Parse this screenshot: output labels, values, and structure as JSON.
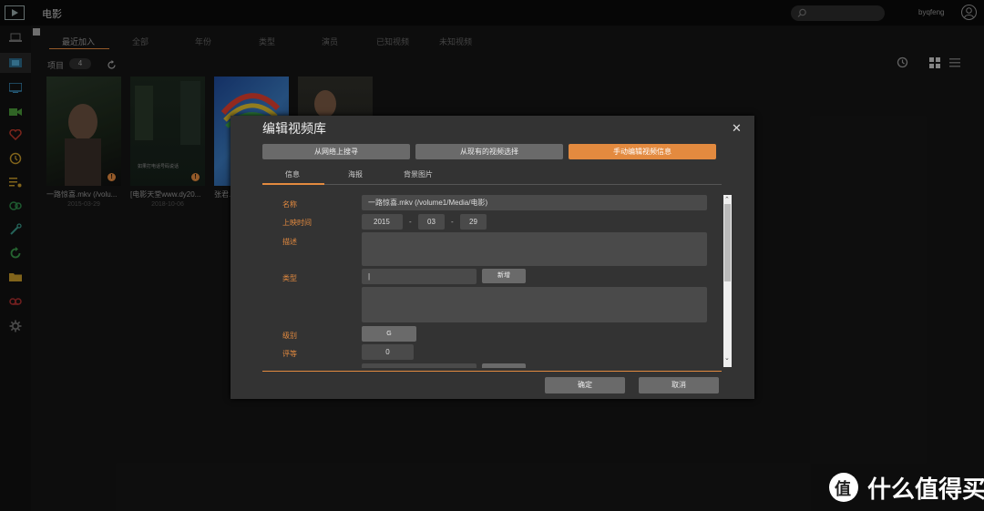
{
  "app": {
    "title": "电影",
    "user": "byqfeng"
  },
  "tabs": [
    "最近加入",
    "全部",
    "年份",
    "类型",
    "演员",
    "已知视频",
    "未知视频"
  ],
  "items": {
    "label": "项目",
    "count": "4"
  },
  "cards": [
    {
      "title": "一路惊喜.mkv (/volu...",
      "date": "2015-03-29",
      "poster_text": ""
    },
    {
      "title": "[电影天堂www.dy20...",
      "date": "2018-10-06",
      "poster_text": "如果打电话号码说话"
    },
    {
      "title": "张君...",
      "date": "",
      "poster_text": ""
    },
    {
      "title": "",
      "date": "",
      "poster_text": ""
    }
  ],
  "dialog": {
    "title": "编辑视频库",
    "source_buttons": [
      "从网络上搜寻",
      "从现有的视频选择",
      "手动编辑视频信息"
    ],
    "tabs": [
      "信息",
      "海报",
      "背景图片"
    ],
    "form": {
      "name_label": "名称",
      "name_value": "一路惊喜.mkv (/volume1/Media/电影)",
      "date_label": "上映时间",
      "year": "2015",
      "month": "03",
      "day": "29",
      "dash": "-",
      "desc_label": "描述",
      "genre_label": "类型",
      "add_label": "新增",
      "rating_label": "级别",
      "rating_value": "G",
      "score_label": "评等",
      "score_value": "0"
    },
    "ok_label": "确定",
    "cancel_label": "取消"
  },
  "watermark": {
    "text": "什么值得买",
    "badge": "值"
  },
  "colors": {
    "accent": "#e38a3f",
    "dialog_bg": "#333333",
    "field_bg": "#4a4a4a",
    "button_bg": "#6a6a6a"
  }
}
